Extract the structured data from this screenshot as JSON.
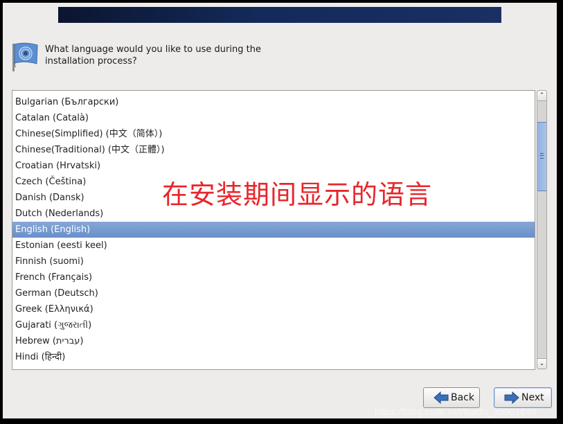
{
  "header": {
    "question_line1": "What language would you like to use during the",
    "question_line2": "installation process?",
    "icon": "language-flag-icon"
  },
  "languages": [
    {
      "label": "Bulgarian (Български)",
      "selected": false
    },
    {
      "label": "Catalan (Català)",
      "selected": false
    },
    {
      "label": "Chinese(Simplified) (中文（简体）)",
      "selected": false
    },
    {
      "label": "Chinese(Traditional) (中文（正體）)",
      "selected": false
    },
    {
      "label": "Croatian (Hrvatski)",
      "selected": false
    },
    {
      "label": "Czech (Čeština)",
      "selected": false
    },
    {
      "label": "Danish (Dansk)",
      "selected": false
    },
    {
      "label": "Dutch (Nederlands)",
      "selected": false
    },
    {
      "label": "English (English)",
      "selected": true
    },
    {
      "label": "Estonian (eesti keel)",
      "selected": false
    },
    {
      "label": "Finnish (suomi)",
      "selected": false
    },
    {
      "label": "French (Français)",
      "selected": false
    },
    {
      "label": "German (Deutsch)",
      "selected": false
    },
    {
      "label": "Greek (Ελληνικά)",
      "selected": false
    },
    {
      "label": "Gujarati (ગુજરાતી)",
      "selected": false
    },
    {
      "label": "Hebrew (עברית)",
      "selected": false
    },
    {
      "label": "Hindi (हिन्दी)",
      "selected": false
    }
  ],
  "scrollbar": {
    "up_glyph": "⌃",
    "down_glyph": "⌄"
  },
  "overlay_annotation": "在安装期间显示的语言",
  "buttons": {
    "back": "Back",
    "next": "Next"
  },
  "watermark": "https://blog.csdn.net/baidu_35901646",
  "colors": {
    "selection": "#7199cf",
    "banner": "#132a5a",
    "annotation": "#e8252a"
  }
}
